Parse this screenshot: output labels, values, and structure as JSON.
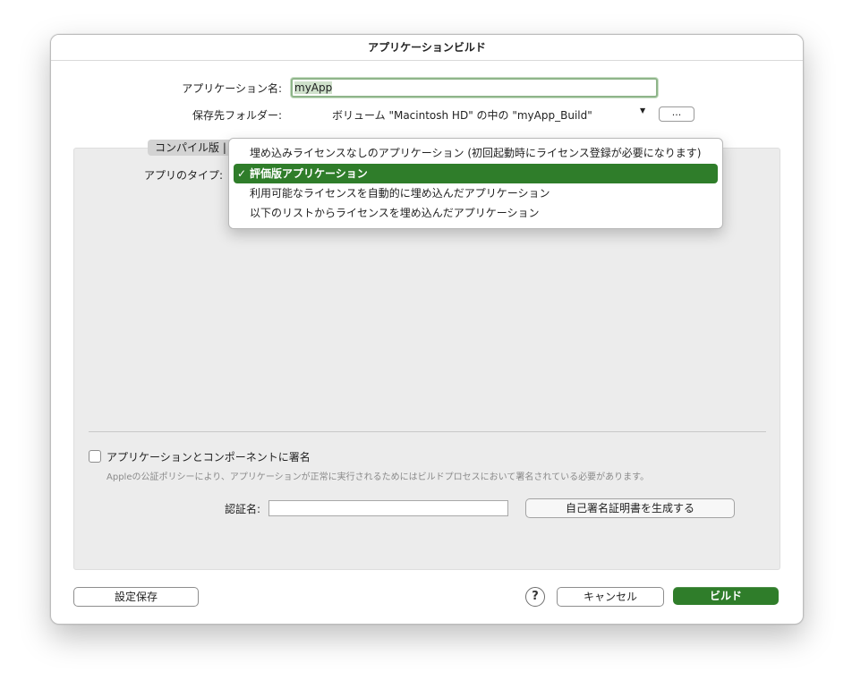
{
  "window": {
    "title": "アプリケーションビルド"
  },
  "form": {
    "app_name_label": "アプリケーション名:",
    "app_name_value": "myApp",
    "dest_folder_label": "保存先フォルダー:",
    "dest_folder_value": "ボリューム \"Macintosh HD\" の中の \"myApp_Build\"",
    "browse_button": "..."
  },
  "tabs": {
    "active": "コンパイル版"
  },
  "app_type": {
    "label": "アプリのタイプ:",
    "options": [
      "埋め込みライセンスなしのアプリケーション (初回起動時にライセンス登録が必要になります)",
      "評価版アプリケーション",
      "利用可能なライセンスを自動的に埋め込んだアプリケーション",
      "以下のリストからライセンスを埋め込んだアプリケーション"
    ],
    "selected_index": 1,
    "check_mark": "✓"
  },
  "signing": {
    "checkbox_label": "アプリケーションとコンポーネントに署名",
    "checked": false,
    "note": "Appleの公証ポリシーにより、アプリケーションが正常に実行されるためにはビルドプロセスにおいて署名されている必要があります。",
    "cert_label": "認証名:",
    "cert_value": "",
    "generate_button": "自己署名証明書を生成する"
  },
  "footer": {
    "save_settings": "設定保存",
    "help": "?",
    "cancel": "キャンセル",
    "build": "ビルド"
  },
  "colors": {
    "accent": "#2f7d2a",
    "panel": "#ececec"
  }
}
